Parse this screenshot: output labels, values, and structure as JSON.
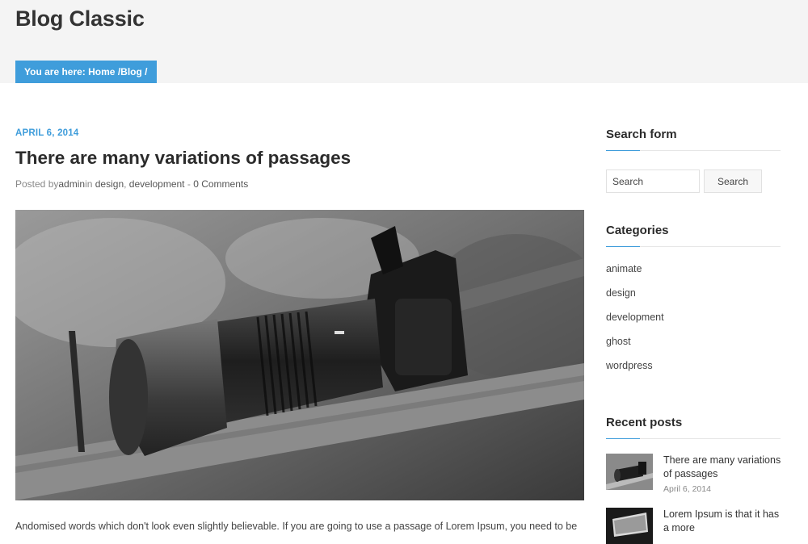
{
  "header": {
    "page_title": "Blog Classic",
    "breadcrumb_prefix": "You are here: ",
    "breadcrumb_home": "Home",
    "breadcrumb_sep1": " /",
    "breadcrumb_blog": "Blog",
    "breadcrumb_sep2": " /"
  },
  "post": {
    "date": "APRIL 6, 2014",
    "title": "There are many variations of passages",
    "meta_prefix": "Posted by",
    "author": "admin",
    "meta_in": "in ",
    "category1": "design",
    "category_sep": ", ",
    "category2": "development",
    "comments_sep": " - ",
    "comments": "0 Comments",
    "excerpt": "Andomised words which don't look even slightly believable. If you are going to use a passage of Lorem Ipsum, you need to be"
  },
  "sidebar": {
    "search": {
      "title": "Search form",
      "placeholder": "Search",
      "button_label": "Search"
    },
    "categories": {
      "title": "Categories",
      "items": [
        "animate",
        "design",
        "development",
        "ghost",
        "wordpress"
      ]
    },
    "recent": {
      "title": "Recent posts",
      "items": [
        {
          "title": "There are many variations of passages",
          "date": "April 6, 2014"
        },
        {
          "title": "Lorem Ipsum is that it has a more",
          "date": ""
        }
      ]
    }
  },
  "colors": {
    "accent": "#3f9ddb",
    "header_bg": "#f4f4f4"
  }
}
